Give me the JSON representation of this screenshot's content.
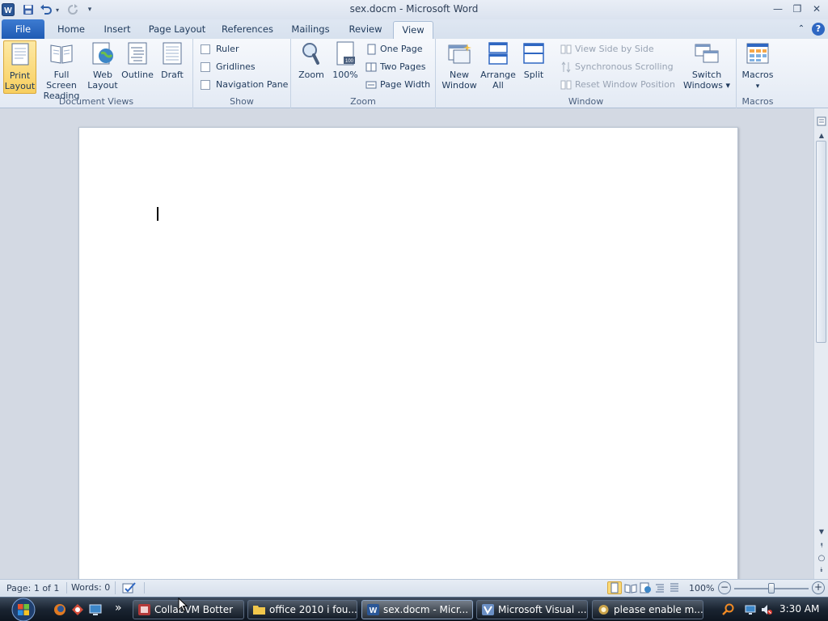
{
  "window": {
    "doc_name": "sex.docm",
    "title_sep": " - ",
    "app_name": "Microsoft Word",
    "minimize": "—",
    "restore": "❐",
    "close": "✕"
  },
  "tabs": [
    "File",
    "Home",
    "Insert",
    "Page Layout",
    "References",
    "Mailings",
    "Review",
    "View"
  ],
  "ribbon": {
    "document_views": {
      "label": "Document Views",
      "buttons": [
        {
          "l1": "Print",
          "l2": "Layout"
        },
        {
          "l1": "Full Screen",
          "l2": "Reading"
        },
        {
          "l1": "Web",
          "l2": "Layout"
        },
        {
          "l1": "Outline",
          "l2": ""
        },
        {
          "l1": "Draft",
          "l2": ""
        }
      ]
    },
    "show": {
      "label": "Show",
      "ruler": "Ruler",
      "gridlines": "Gridlines",
      "nav_pane": "Navigation Pane"
    },
    "zoom": {
      "label": "Zoom",
      "zoom": "Zoom",
      "pct": "100%",
      "one_page": "One Page",
      "two_pages": "Two Pages",
      "page_width": "Page Width"
    },
    "window": {
      "label": "Window",
      "new_window_l1": "New",
      "new_window_l2": "Window",
      "arrange_l1": "Arrange",
      "arrange_l2": "All",
      "split": "Split",
      "side_by_side": "View Side by Side",
      "sync_scroll": "Synchronous Scrolling",
      "reset_pos": "Reset Window Position",
      "switch_l1": "Switch",
      "switch_l2": "Windows ▾"
    },
    "macros": {
      "label": "Macros",
      "btn": "Macros",
      "arrow": "▾"
    }
  },
  "status": {
    "page": "Page: 1 of 1",
    "words": "Words: 0",
    "zoom": "100%",
    "minus": "−",
    "plus": "+"
  },
  "taskbar": {
    "items": [
      {
        "label": "CollabVM Botter"
      },
      {
        "label": "office 2010 i fou..."
      },
      {
        "label": "sex.docm - Micr..."
      },
      {
        "label": "Microsoft Visual ..."
      },
      {
        "label": "please enable m..."
      }
    ],
    "quicklaunch_more": "»",
    "clock": "3:30 AM"
  },
  "colors": {
    "accent": "#2b579a",
    "file_tab": "#2a64bd",
    "selected_button": "#f8cf5f",
    "taskbar": "#1a2431"
  }
}
